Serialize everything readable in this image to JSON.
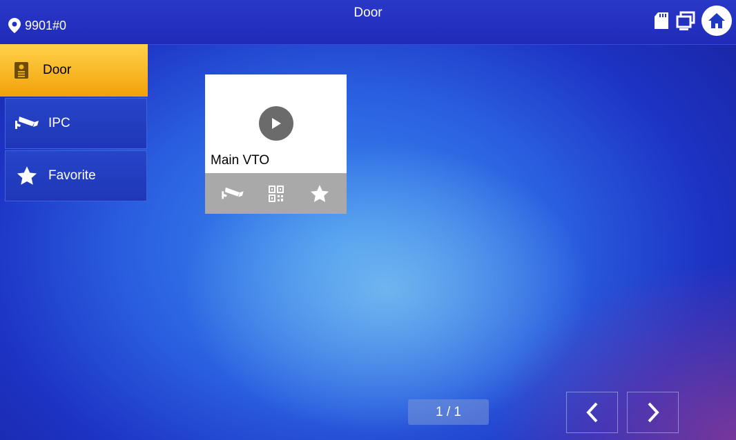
{
  "header": {
    "location": "9901#0",
    "title": "Door",
    "icons": [
      "location-pin-icon",
      "sd-card-icon",
      "multi-screen-icon",
      "home-icon"
    ]
  },
  "sidebar": {
    "items": [
      {
        "label": "Door",
        "icon": "door-intercom-icon",
        "active": true
      },
      {
        "label": "IPC",
        "icon": "camera-icon",
        "active": false
      },
      {
        "label": "Favorite",
        "icon": "star-icon",
        "active": false
      }
    ]
  },
  "device_card": {
    "name": "Main VTO",
    "actions": [
      "camera-icon",
      "qr-code-icon",
      "star-icon"
    ]
  },
  "pagination": {
    "page": "1 / 1"
  },
  "colors": {
    "active_tab": "#f2a10a",
    "topbar": "#2231bf",
    "card_bar": "#a9a9a9"
  }
}
